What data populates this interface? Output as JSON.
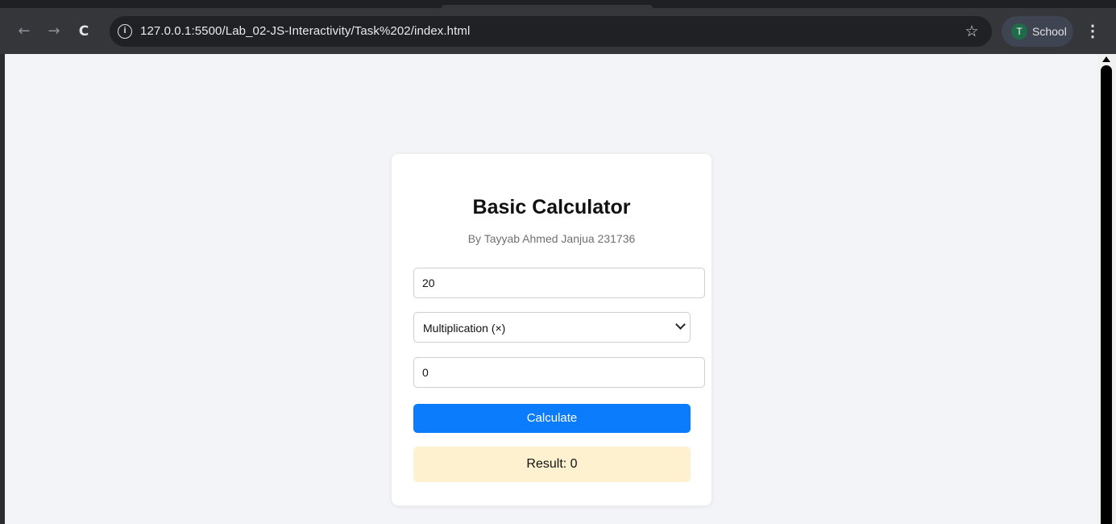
{
  "browser": {
    "url": "127.0.0.1:5500/Lab_02-JS-Interactivity/Task%202/index.html",
    "profile_initial": "T",
    "profile_name": "School",
    "back_glyph": "←",
    "forward_glyph": "→",
    "reload_glyph": "C",
    "info_glyph": "i",
    "star_glyph": "☆",
    "menu_glyph": "⋮"
  },
  "calculator": {
    "title": "Basic Calculator",
    "subtitle": "By Tayyab Ahmed Janjua 231736",
    "first_number": "20",
    "operation": "Multiplication (×)",
    "second_number": "0",
    "calculate_label": "Calculate",
    "result_text": "Result: 0"
  },
  "colors": {
    "accent": "#0b7cfb",
    "result_background": "#fdf1cf",
    "page_background": "#f3f4f7"
  }
}
